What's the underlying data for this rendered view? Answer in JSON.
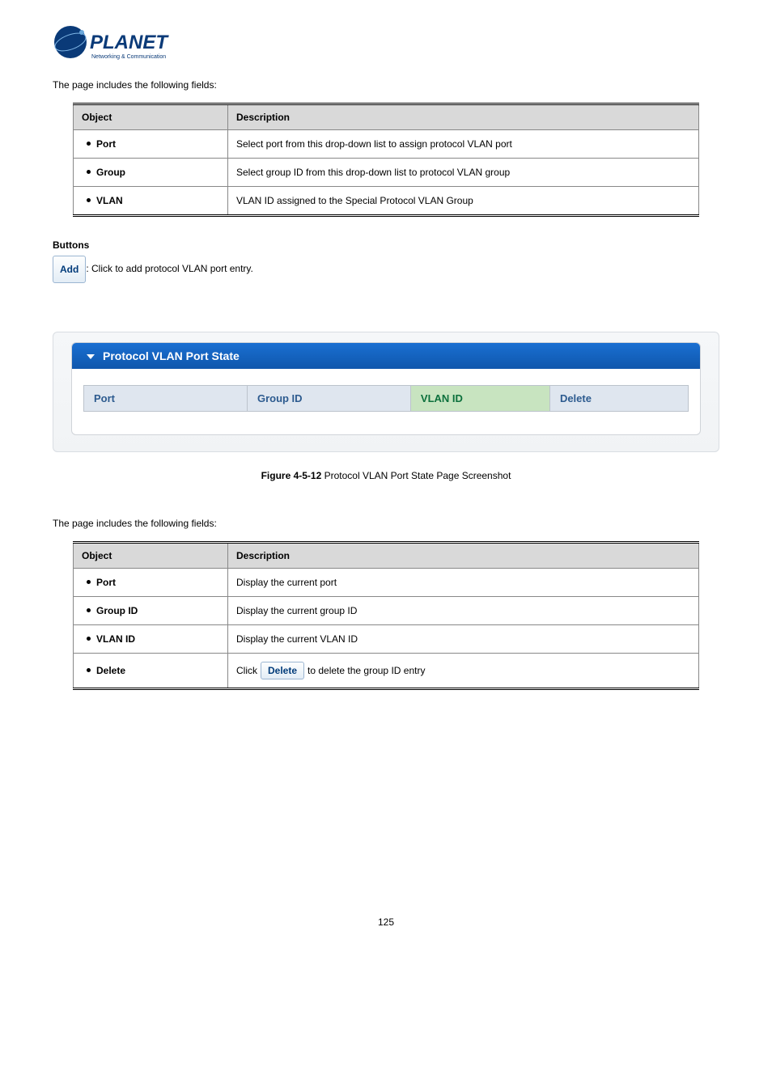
{
  "logo": {
    "brand": "PLANET",
    "tagline": "Networking & Communication"
  },
  "intro1": "The page includes the following fields:",
  "table1": {
    "headers": {
      "object": "Object",
      "description": "Description"
    },
    "rows": [
      {
        "obj": "Port",
        "desc": "Select port from this drop-down list to assign protocol VLAN port"
      },
      {
        "obj": "Group",
        "desc": "Select group ID from this drop-down list to protocol VLAN group"
      },
      {
        "obj": "VLAN",
        "desc": "VLAN ID assigned to the Special Protocol VLAN Group"
      }
    ]
  },
  "buttons_heading": "Buttons",
  "add_btn": "Add",
  "add_btn_desc": ": Click to add protocol VLAN port entry.",
  "panel": {
    "title": "Protocol VLAN Port State",
    "headers": {
      "port": "Port",
      "group_id": "Group ID",
      "vlan_id": "VLAN ID",
      "delete": "Delete"
    }
  },
  "figcap_label": "Figure 4-5-12",
  "figcap_text": " Protocol VLAN Port State Page Screenshot",
  "intro2": "The page includes the following fields:",
  "table2": {
    "headers": {
      "object": "Object",
      "description": "Description"
    },
    "rows": [
      {
        "obj": "Port",
        "desc": "Display the current port"
      },
      {
        "obj": "Group ID",
        "desc": "Display the current group ID"
      },
      {
        "obj": "VLAN ID",
        "desc": "Display the current VLAN ID"
      },
      {
        "obj": "Delete",
        "desc_pre": "Click ",
        "btn": "Delete",
        "desc_post": " to delete the group ID entry"
      }
    ]
  },
  "page_number": "125"
}
